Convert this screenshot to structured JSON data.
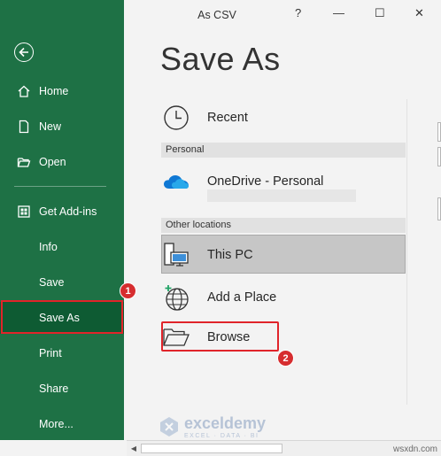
{
  "window": {
    "title": "As CSV",
    "help": "?",
    "minimize": "—",
    "maximize": "☐",
    "close": "✕"
  },
  "sidebar": {
    "items": [
      {
        "label": "Home",
        "icon": "home-icon"
      },
      {
        "label": "New",
        "icon": "new-document-icon"
      },
      {
        "label": "Open",
        "icon": "folder-open-icon"
      },
      {
        "label": "Get Add-ins",
        "icon": "addins-icon"
      },
      {
        "label": "Info"
      },
      {
        "label": "Save"
      },
      {
        "label": "Save As",
        "active": true
      },
      {
        "label": "Print"
      },
      {
        "label": "Share"
      },
      {
        "label": "More..."
      }
    ]
  },
  "page_title": "Save As",
  "locations": {
    "recent": "Recent",
    "personal_header": "Personal",
    "onedrive": "OneDrive - Personal",
    "other_header": "Other locations",
    "this_pc": "This PC",
    "add_place": "Add a Place",
    "browse": "Browse"
  },
  "badges": {
    "first": "1",
    "second": "2"
  },
  "watermark": {
    "brand": "exceldemy",
    "sub": "EXCEL · DATA · BI",
    "site": "wsxdn.com"
  },
  "colors": {
    "sidebar": "#1e7145",
    "active": "#0e5b33",
    "highlight": "#e0242a"
  }
}
